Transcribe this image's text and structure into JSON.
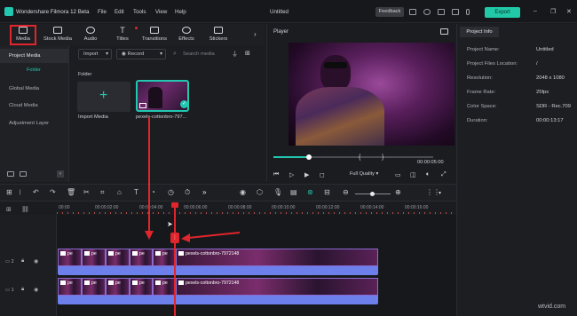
{
  "app": {
    "name": "Wondershare Filmora 12 Beta",
    "menu": [
      "File",
      "Edit",
      "Tools",
      "View",
      "Help"
    ],
    "project_title": "Untitled",
    "feedback_label": "Feedback",
    "export_label": "Export",
    "accent_color": "#22c7b0",
    "highlight_color": "#e0262c"
  },
  "tabs": [
    {
      "label": "Media",
      "icon": "media-icon",
      "selected": true
    },
    {
      "label": "Stock Media",
      "icon": "stock-media-icon"
    },
    {
      "label": "Audio",
      "icon": "music-note-icon"
    },
    {
      "label": "Titles",
      "icon": "text-icon"
    },
    {
      "label": "Transitions",
      "icon": "transitions-icon"
    },
    {
      "label": "Effects",
      "icon": "effects-icon"
    },
    {
      "label": "Stickers",
      "icon": "stickers-icon"
    }
  ],
  "sidebar": {
    "items": [
      "Project Media",
      "Global Media",
      "Cloud Media",
      "Adjustment Layer"
    ],
    "folder_label": "Folder"
  },
  "media": {
    "import_dropdown": "Import",
    "record_dropdown": "Record",
    "search_placeholder": "Search media",
    "folder_heading": "Folder",
    "import_card_label": "Import Media",
    "clip_label": "pexels-cottonbro-797..."
  },
  "player": {
    "label": "Player",
    "time": "00:00:05:00",
    "quality": "Full Quality",
    "progress_fraction": 0.22
  },
  "project_info": {
    "tab_label": "Project Info",
    "rows": [
      {
        "key": "Project Name:",
        "value": "Untitled"
      },
      {
        "key": "Project Files Location:",
        "value": "/"
      },
      {
        "key": "Resolution:",
        "value": "2048 x 1080"
      },
      {
        "key": "Frame Rate:",
        "value": "25fps"
      },
      {
        "key": "Color Space:",
        "value": "SDR - Rec.709"
      },
      {
        "key": "Duration:",
        "value": "00:00:13:17"
      }
    ]
  },
  "timeline": {
    "ruler": [
      "00:00",
      "00:00:02:00",
      "00:00:04:00",
      "00:00:06:00",
      "00:00:08:00",
      "00:00:10:00",
      "00:00:12:00",
      "00:00:14:00",
      "00:00:16:00"
    ],
    "tracks": [
      {
        "label": "2",
        "clip_caption": "pexels-cottonbro-7972148",
        "short_captions": [
          "pe",
          "pe",
          "pe",
          "pe",
          "pe"
        ]
      },
      {
        "label": "1",
        "clip_caption": "pexels-cottonbro-7972148",
        "short_captions": [
          "pe",
          "pe",
          "pe",
          "pe",
          "pe"
        ]
      }
    ]
  },
  "watermark": "wtvid.com"
}
